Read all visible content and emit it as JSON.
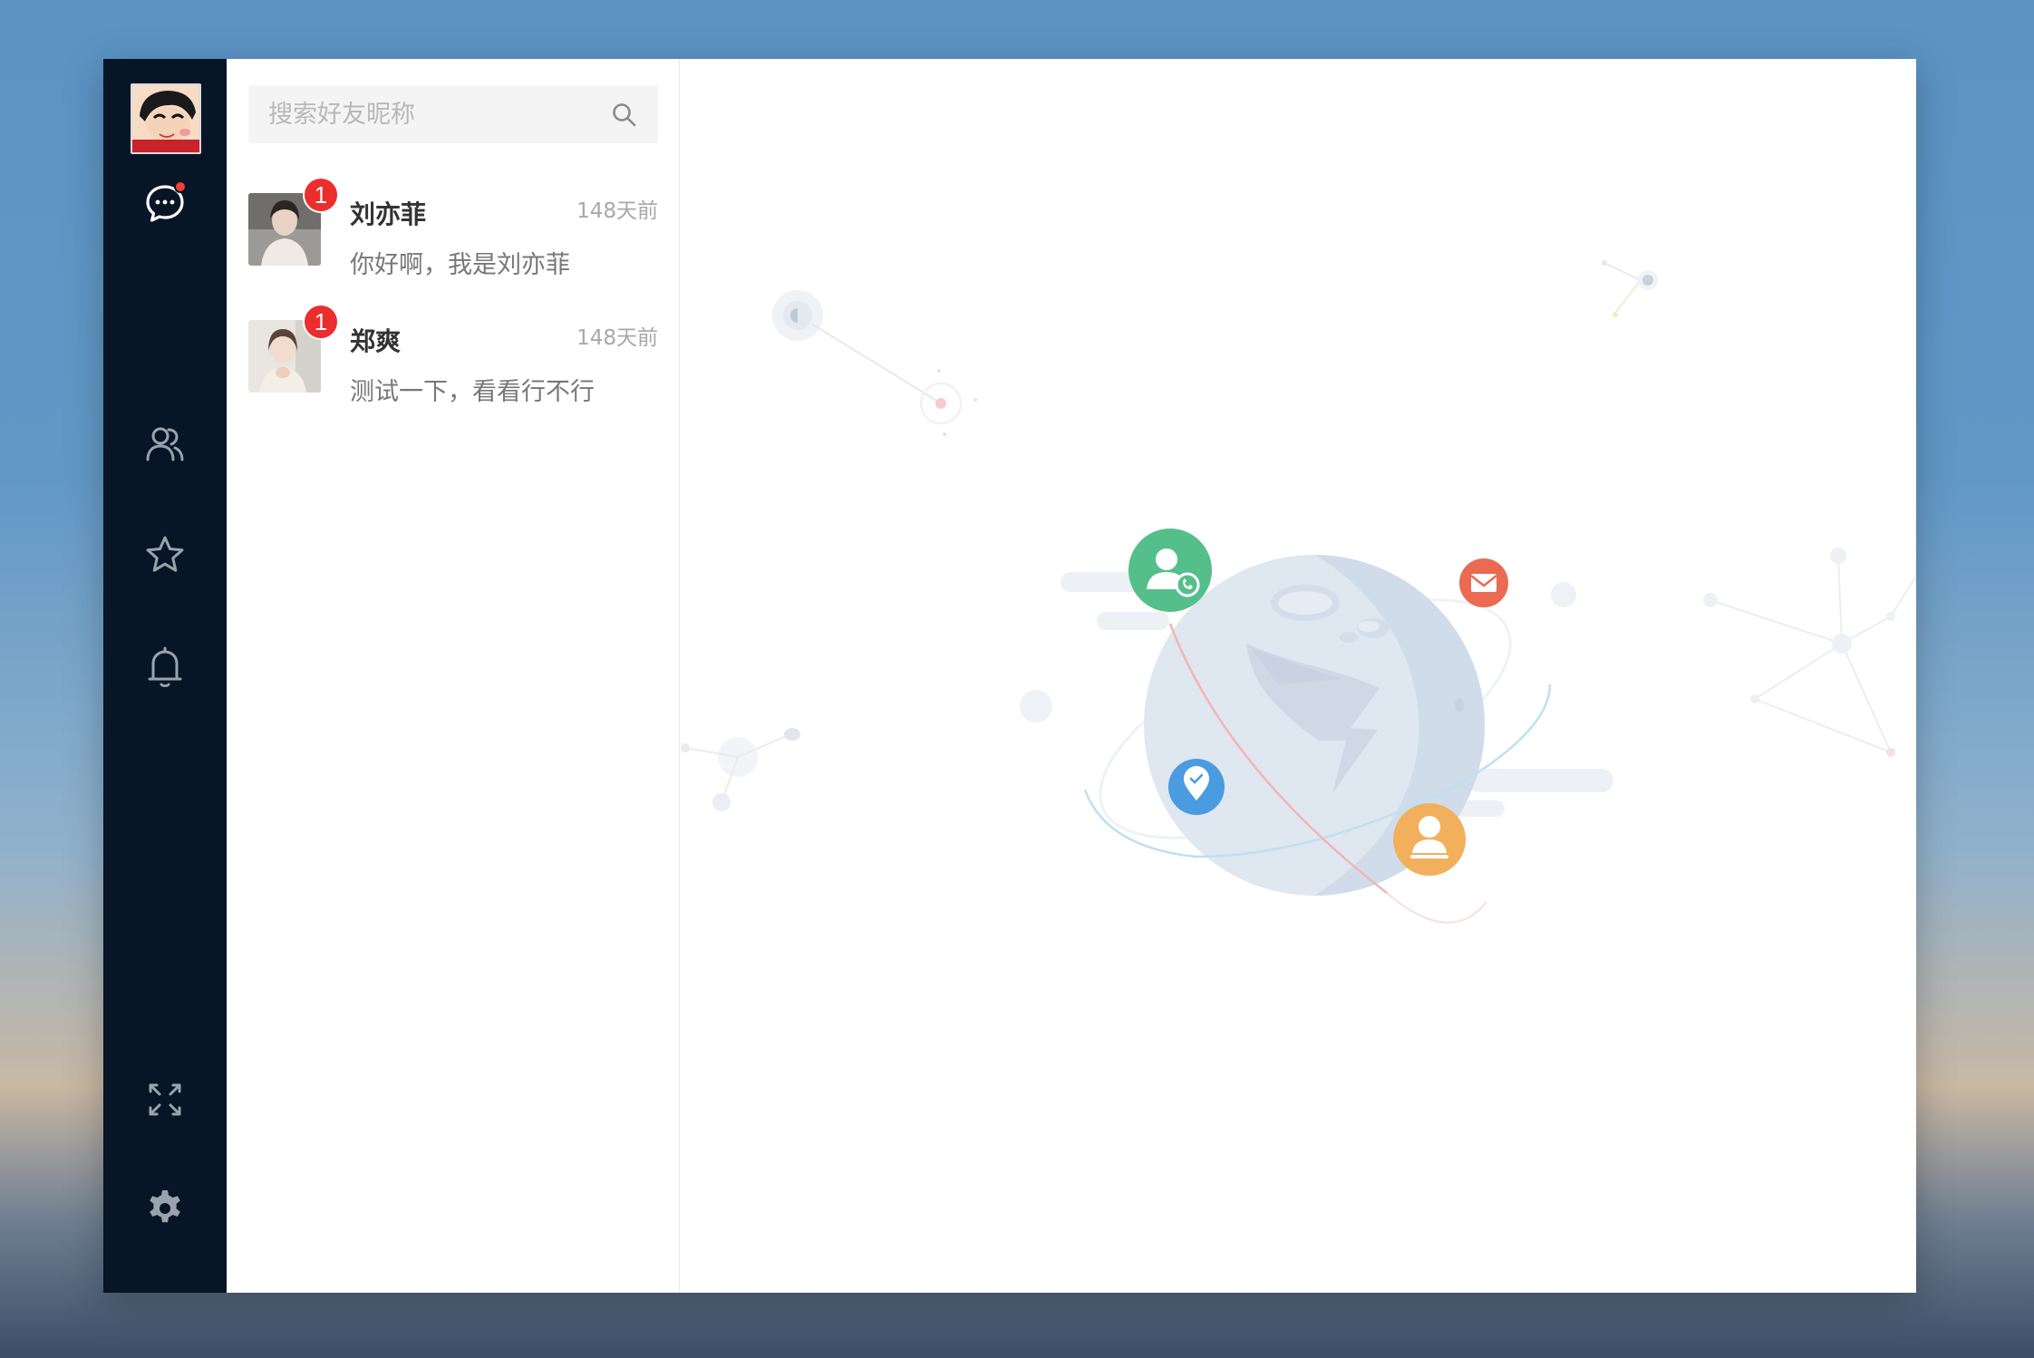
{
  "nav": {
    "items": [
      {
        "name": "chat",
        "icon": "chat-bubble-icon",
        "has_dot": true
      },
      {
        "name": "contacts",
        "icon": "contacts-icon",
        "has_dot": false
      },
      {
        "name": "favorites",
        "icon": "star-icon",
        "has_dot": false
      },
      {
        "name": "notifications",
        "icon": "bell-icon",
        "has_dot": false
      }
    ],
    "bottom": [
      {
        "name": "fullscreen",
        "icon": "expand-icon"
      },
      {
        "name": "settings",
        "icon": "gear-icon"
      }
    ]
  },
  "search": {
    "placeholder": "搜索好友昵称",
    "value": ""
  },
  "conversations": [
    {
      "name": "刘亦菲",
      "time": "148天前",
      "message": "你好啊，我是刘亦菲",
      "unread": "1"
    },
    {
      "name": "郑爽",
      "time": "148天前",
      "message": "测试一下，看看行不行",
      "unread": "1"
    }
  ],
  "colors": {
    "nav_bg": "#071527",
    "badge": "#ec2d2d",
    "green": "#4dbf8a",
    "blue": "#4a9be0",
    "orange": "#f2b05c",
    "red": "#ea6a52"
  }
}
